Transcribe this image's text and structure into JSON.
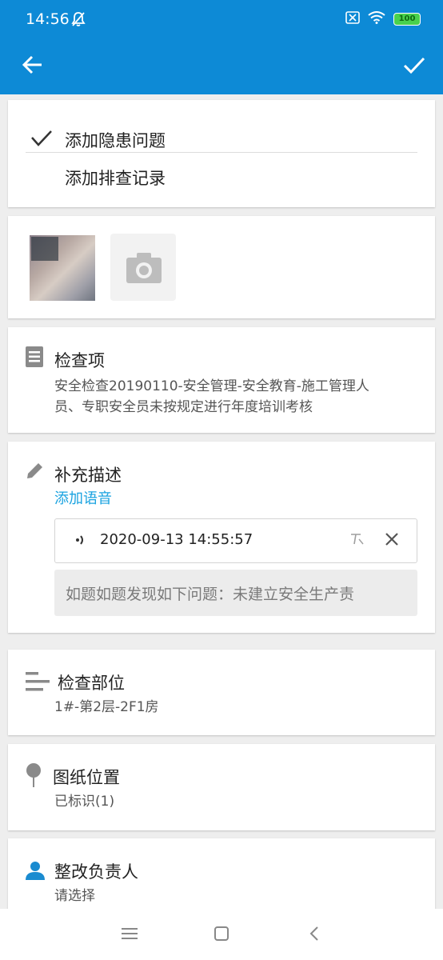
{
  "status_bar": {
    "time": "14:56",
    "battery": "100"
  },
  "app_bar": {
    "back_icon": "arrow-left-icon",
    "confirm_icon": "check-icon"
  },
  "record_type": {
    "options": [
      {
        "label": "添加隐患问题",
        "selected": true
      },
      {
        "label": "添加排查记录",
        "selected": false
      }
    ]
  },
  "photos": {
    "add_icon": "camera-icon"
  },
  "check_item": {
    "title": "检查项",
    "line1": "安全检查20190110-安全管理-安全教育-施工管理人",
    "line2": "员、专职安全员未按规定进行年度培训考核"
  },
  "description": {
    "title": "补充描述",
    "add_voice": "添加语音",
    "voice_timestamp": "2020-09-13 14:55:57",
    "transcript": "如题如题发现如下问题：未建立安全生产责"
  },
  "location": {
    "title": "检查部位",
    "value": "1#-第2层-2F1房"
  },
  "drawing": {
    "title": "图纸位置",
    "value": "已标识(1)"
  },
  "owner": {
    "title": "整改负责人",
    "placeholder": "请选择"
  },
  "colors": {
    "primary": "#0d8ad6",
    "link": "#1aa3e0"
  }
}
